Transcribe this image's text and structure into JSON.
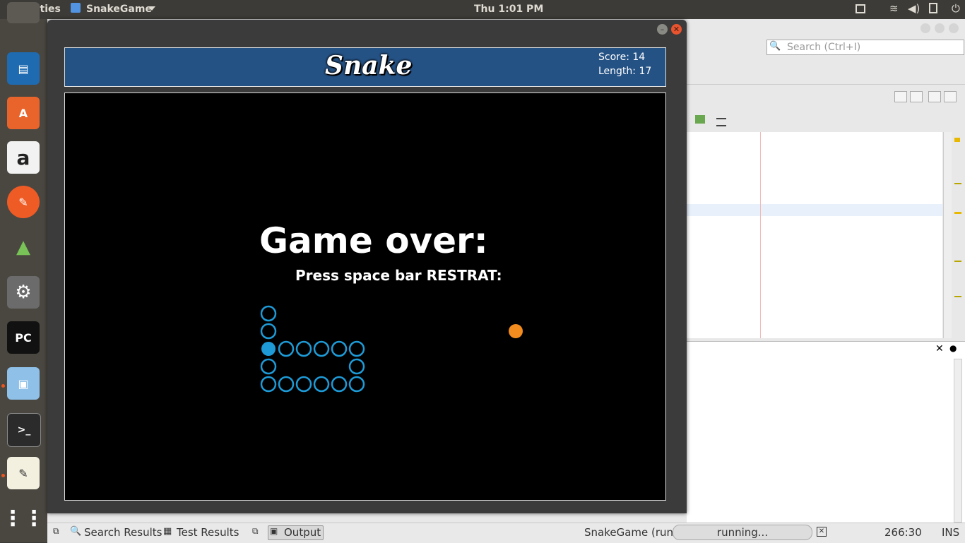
{
  "topbar": {
    "activities": "Activities",
    "app_name": "SnakeGame",
    "clock": "Thu  1:01 PM"
  },
  "dock": {
    "items": [
      "libreoffice-writer-icon",
      "ubuntu-software-icon",
      "amazon-icon",
      "postman-icon",
      "android-studio-icon",
      "system-settings-icon",
      "pycharm-icon",
      "virtualbox-icon",
      "terminal-icon",
      "text-editor-icon",
      "show-apps-icon"
    ],
    "pycharm_label": "PC"
  },
  "ide": {
    "search_placeholder": "Search (Ctrl+I)"
  },
  "game": {
    "title": "Snake",
    "score": "Score: 14",
    "length": "Length: 17",
    "game_over": "Game over:",
    "restart_hint": "Press space bar RESTRAT:",
    "snake_color": "#1e9bd7",
    "food_color": "#f28c1e",
    "header_color": "#255285"
  },
  "statusbar": {
    "search_results": "Search Results",
    "test_results": "Test Results",
    "output": "Output",
    "run_label": "SnakeGame (run)",
    "progress_text": "running...",
    "position": "266:30",
    "mode": "INS"
  }
}
